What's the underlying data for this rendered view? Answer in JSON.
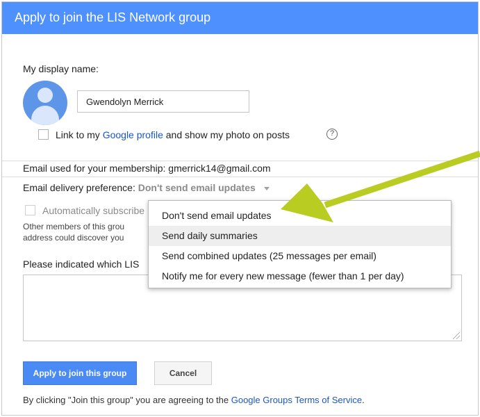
{
  "dialog": {
    "title": "Apply to join the LIS Network group"
  },
  "profile": {
    "display_name_label": "My display name:",
    "display_name_value": "Gwendolyn Merrick",
    "link_profile_prefix": "Link to my ",
    "link_profile_link": "Google profile",
    "link_profile_suffix": " and show my photo on posts",
    "help_glyph": "?"
  },
  "membership": {
    "email_text": "Email used for your membership: gmerrick14@gmail.com"
  },
  "delivery": {
    "label": "Email delivery preference: ",
    "value": "Don't send email updates",
    "options": [
      "Don't send email updates",
      "Send daily summaries",
      "Send combined updates (25 messages per email)",
      "Notify me for every new message (fewer than 1 per day)"
    ],
    "highlighted_index": 1
  },
  "auto_subscribe": {
    "label": "Automatically subscribe",
    "note_line1": "Other members of this grou",
    "note_line2": "address could discover you"
  },
  "question": {
    "label": "Please indicated which LIS"
  },
  "actions": {
    "apply_label": "Apply to join this group",
    "cancel_label": "Cancel"
  },
  "footer": {
    "terms_prefix": "By clicking \"Join this group\" you are agreeing to the ",
    "terms_link": "Google Groups Terms of Service",
    "terms_suffix": "."
  },
  "colors": {
    "title_bar": "#4d90fe",
    "primary_button": "#4a8af4",
    "link": "#1a56c9",
    "annotation_arrow": "#b8cc22"
  }
}
